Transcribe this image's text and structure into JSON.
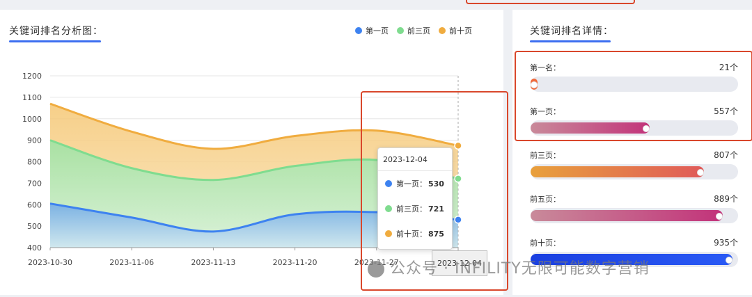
{
  "left_panel": {
    "title": "关键词排名分析图："
  },
  "legend": [
    {
      "label": "第一页",
      "color": "#3d82f0"
    },
    {
      "label": "前三页",
      "color": "#7fdc8f"
    },
    {
      "label": "前十页",
      "color": "#f0ac3f"
    }
  ],
  "chart_data": {
    "type": "area",
    "x": [
      "2023-10-30",
      "2023-11-06",
      "2023-11-13",
      "2023-11-20",
      "2023-11-27",
      "2023-12-04"
    ],
    "ylim": [
      400,
      1200
    ],
    "yticks": [
      400,
      500,
      600,
      700,
      800,
      900,
      1000,
      1100,
      1200
    ],
    "series": [
      {
        "name": "第一页",
        "color": "#3d82f0",
        "values": [
          605,
          540,
          475,
          555,
          565,
          530
        ]
      },
      {
        "name": "前三页",
        "color": "#7fdc8f",
        "values": [
          900,
          770,
          715,
          780,
          808,
          721
        ]
      },
      {
        "name": "前十页",
        "color": "#f0ac3f",
        "values": [
          1070,
          940,
          860,
          920,
          945,
          875
        ]
      }
    ],
    "grid": true,
    "legend_position": "top-right"
  },
  "tooltip": {
    "date": "2023-12-04",
    "rows": [
      {
        "label": "第一页：",
        "value": "530",
        "color": "#3d82f0"
      },
      {
        "label": "前三页：",
        "value": "721",
        "color": "#7fdc8f"
      },
      {
        "label": "前十页：",
        "value": "875",
        "color": "#f0ac3f"
      }
    ]
  },
  "axis_pointer_label": "2023-12-04",
  "right_panel": {
    "title": "关键词排名详情：",
    "stats": [
      {
        "label": "第一名：",
        "value": "21个",
        "fraction": 0.02,
        "gradient": [
          "#f06a3c",
          "#f06a3c"
        ]
      },
      {
        "label": "第一页：",
        "value": "557个",
        "fraction": 0.59,
        "gradient": [
          "#c98a9a",
          "#c2337a"
        ]
      },
      {
        "label": "前三页：",
        "value": "807个",
        "fraction": 0.86,
        "gradient": [
          "#e8a03c",
          "#e05a5a"
        ]
      },
      {
        "label": "前五页：",
        "value": "889个",
        "fraction": 0.95,
        "gradient": [
          "#c98a9a",
          "#c2337a"
        ]
      },
      {
        "label": "前十页：",
        "value": "935个",
        "fraction": 1.0,
        "gradient": [
          "#1a3fe0",
          "#2a5af5"
        ]
      }
    ]
  },
  "watermark": "公众号 · INFILITY无限可能数字营销"
}
